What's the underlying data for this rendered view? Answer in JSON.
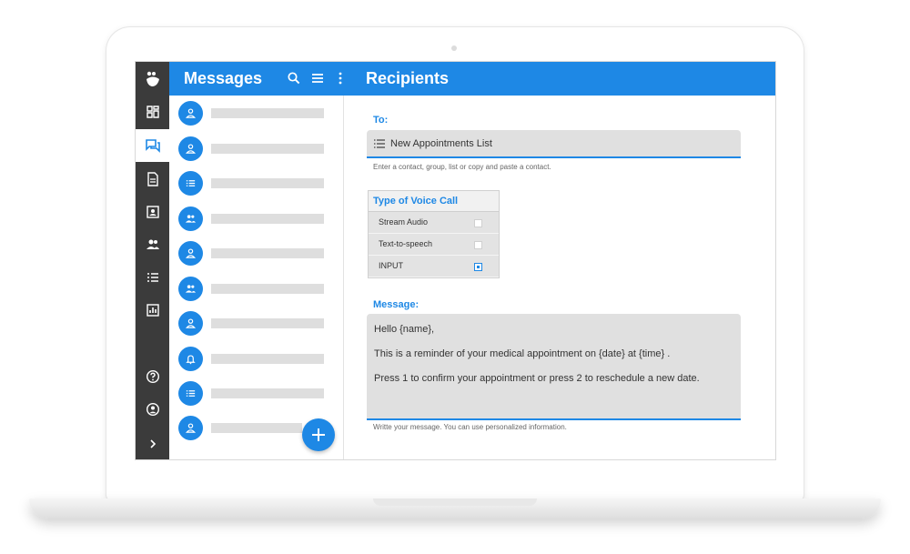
{
  "app": {
    "messages_title": "Messages",
    "recipients_title": "Recipients"
  },
  "colors": {
    "accent": "#1e88e5",
    "rail": "#3b3b3b",
    "field_bg": "#e0e0e0"
  },
  "rail": {
    "logo_icon": "app-logo",
    "items": [
      {
        "icon": "dashboard-icon",
        "active": false
      },
      {
        "icon": "messages-icon",
        "active": true
      },
      {
        "icon": "document-icon",
        "active": false
      },
      {
        "icon": "contact-card-icon",
        "active": false
      },
      {
        "icon": "group-icon",
        "active": false
      },
      {
        "icon": "list-icon",
        "active": false
      },
      {
        "icon": "reports-icon",
        "active": false
      },
      {
        "icon": "help-icon",
        "active": false
      },
      {
        "icon": "account-icon",
        "active": false
      },
      {
        "icon": "expand-icon",
        "active": false
      }
    ]
  },
  "toolbar": {
    "icons": [
      "search-icon",
      "menu-icon",
      "more-icon"
    ]
  },
  "message_list": {
    "items": [
      {
        "avatar_icon": "person-icon"
      },
      {
        "avatar_icon": "person-icon"
      },
      {
        "avatar_icon": "list-icon"
      },
      {
        "avatar_icon": "group-icon"
      },
      {
        "avatar_icon": "person-icon"
      },
      {
        "avatar_icon": "group-icon"
      },
      {
        "avatar_icon": "person-icon"
      },
      {
        "avatar_icon": "bell-icon"
      },
      {
        "avatar_icon": "list-icon"
      },
      {
        "avatar_icon": "person-icon"
      }
    ],
    "fab_icon": "plus-icon"
  },
  "recipients": {
    "to_label": "To:",
    "to_value": "New Appointments List",
    "to_hint": "Enter a contact, group, list or copy and paste a contact.",
    "voice_type_title": "Type of Voice Call",
    "voice_options": [
      {
        "label": "Stream Audio",
        "checked": false
      },
      {
        "label": "Text-to-speech",
        "checked": false
      },
      {
        "label": "INPUT",
        "checked": true
      }
    ],
    "message_label": "Message:",
    "message_lines": [
      "Hello {name},",
      "This is a reminder of your medical appointment on {date} at {time} .",
      "Press 1 to confirm your appointment or press 2 to reschedule a new date."
    ],
    "message_hint": "Writte your message. You can use personalized information."
  }
}
